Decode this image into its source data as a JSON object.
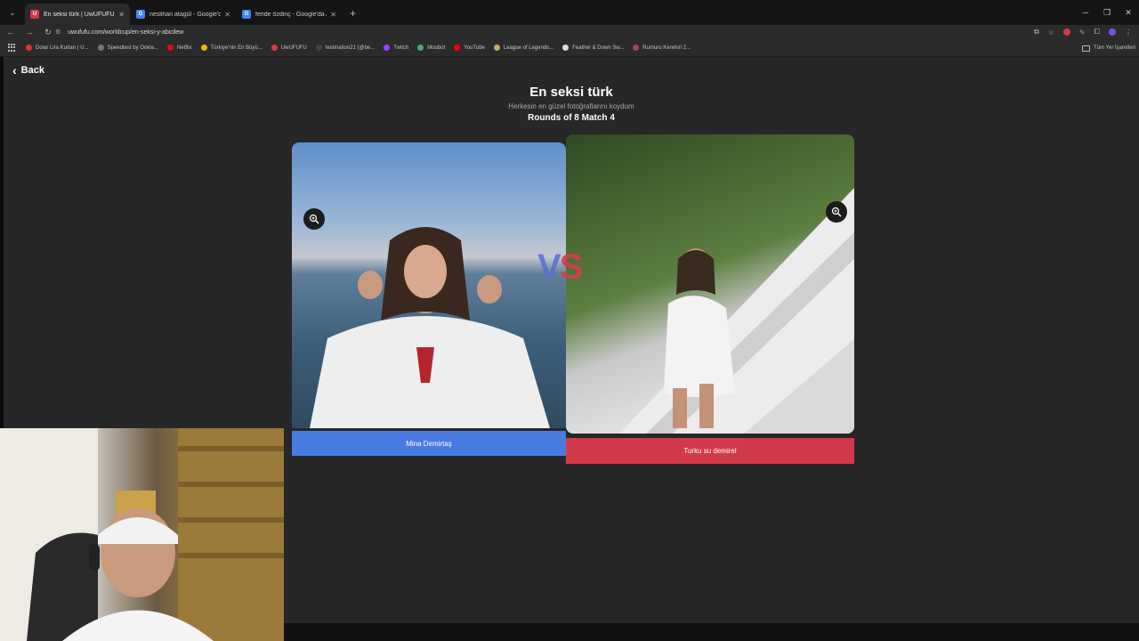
{
  "browser": {
    "tabs": [
      {
        "title": "En seksi türk | UwUFUFU",
        "favicon_color": "#d33a49",
        "favicon_letter": "U",
        "active": true
      },
      {
        "title": "neslihan atagül - Google'da Ara",
        "favicon_color": "#4285f4",
        "favicon_letter": "G",
        "active": false
      },
      {
        "title": "feride özdinç - Google'da Ara",
        "favicon_color": "#4285f4",
        "favicon_letter": "G",
        "active": false
      }
    ],
    "url": "uwufufu.com/worldcup/en-seksi-y-abcdew",
    "bookmarks": [
      {
        "label": "Dolar Lira Kurları | U...",
        "color": "#e0313b"
      },
      {
        "label": "Speedtest by Ookla...",
        "color": "#777777"
      },
      {
        "label": "Netflix",
        "color": "#e50914"
      },
      {
        "label": "Türkiye'nin En Büyü...",
        "color": "#f5b400"
      },
      {
        "label": "UwUFUFU",
        "color": "#d33a49"
      },
      {
        "label": "testination21 (@be...",
        "color": "#444444"
      },
      {
        "label": "Twitch",
        "color": "#9146ff"
      },
      {
        "label": "Moobot",
        "color": "#3fb06b"
      },
      {
        "label": "YouTube",
        "color": "#ff0000"
      },
      {
        "label": "League of Legends...",
        "color": "#c8aa6e"
      },
      {
        "label": "Feather & Down Sw...",
        "color": "#dddddd"
      },
      {
        "label": "Rumuru Kerehiri 2...",
        "color": "#b03a6a"
      }
    ],
    "other_bookmarks": "Tüm Yer İşaretleri"
  },
  "page": {
    "back_label": "Back",
    "title": "En seksi türk",
    "description": "Herkesin en güzel fotoğraflarını koydum",
    "rounds": "Rounds of 8 Match 4",
    "vs_v": "V",
    "vs_s": "S",
    "left_choice": "Mina Demirtaş",
    "right_choice": "Turku su demirel"
  },
  "icons": {
    "zoom": "zoom-in-icon",
    "back": "chevron-left-icon"
  },
  "colors": {
    "left_button": "#4a7be0",
    "right_button": "#d33a49",
    "page_background": "#272727"
  }
}
